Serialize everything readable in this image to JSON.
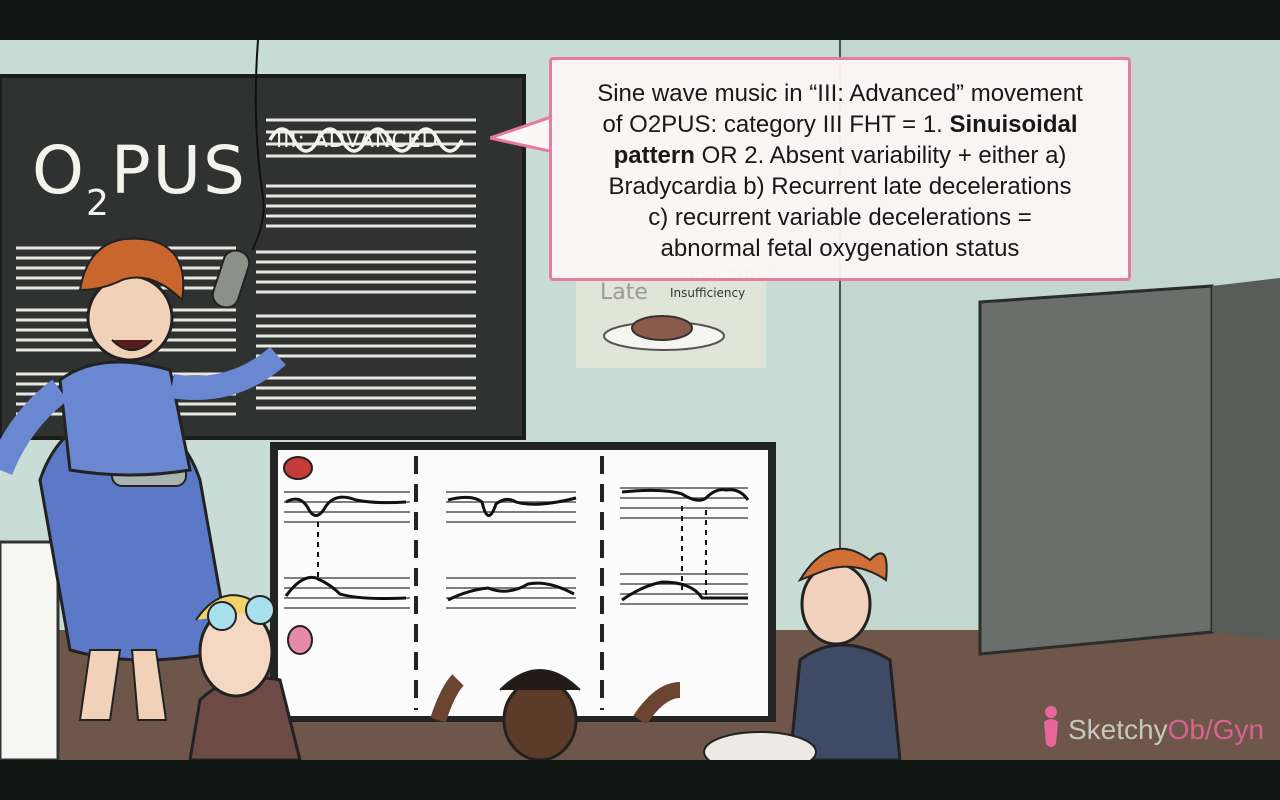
{
  "chalkboard": {
    "title_main": "O",
    "title_sub": "2",
    "title_end": "PUS",
    "movement_label": "III: ADVANCED"
  },
  "poster": {
    "placental": "Placental",
    "insufficiency": "Insufficiency",
    "late": "Late"
  },
  "callout": {
    "line1": "Sine wave music in “III: Advanced” movement",
    "line2_pre": "of O2PUS: category III FHT = 1. ",
    "line2_bold": "Sinuisoidal",
    "line3_bold": "pattern",
    "line3_post": " OR 2. Absent variability + either a)",
    "line4": "Bradycardia b) Recurrent late decelerations",
    "line5": "c) recurrent variable decelerations =",
    "line6": "abnormal fetal oxygenation status"
  },
  "logo": {
    "part1": "Sketchy",
    "part2": "Ob/Gyn"
  },
  "colors": {
    "wall": "#c9dcd6",
    "chalkboard": "#2f3230",
    "callout_border": "#e77aa0",
    "dress": "#5b79c6",
    "hair": "#c8662e",
    "logo_accent": "#e8679a"
  }
}
